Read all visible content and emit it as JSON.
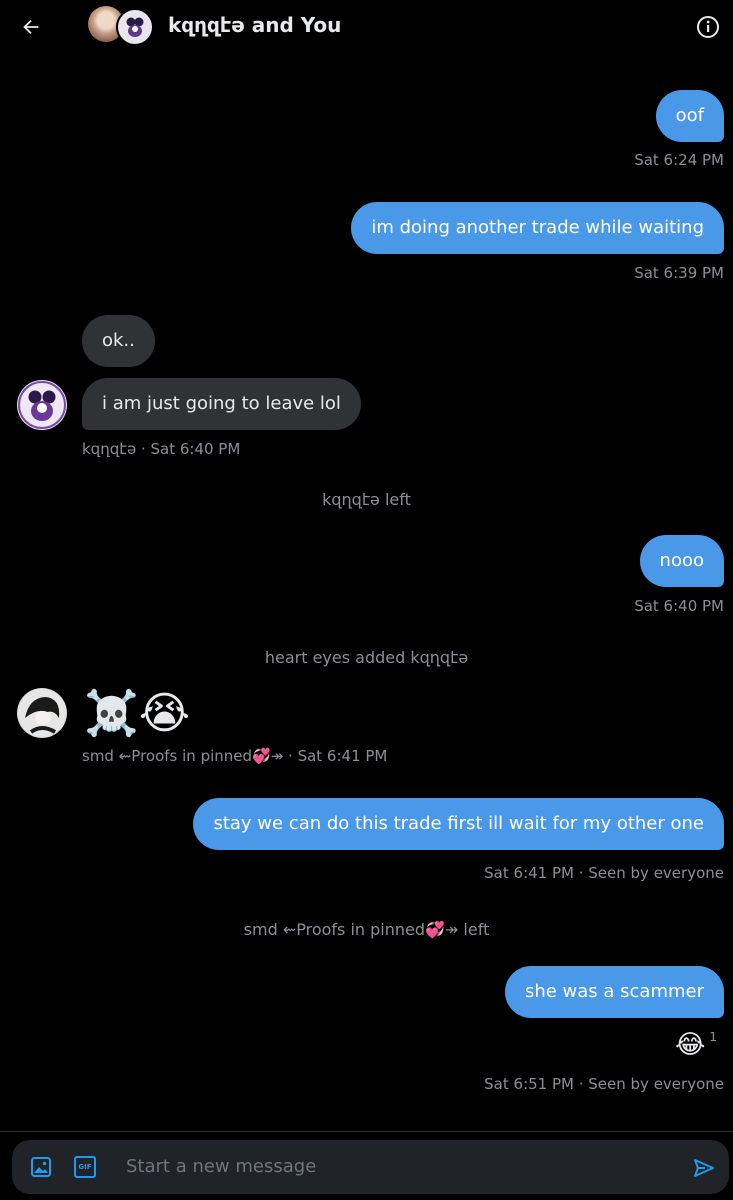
{
  "header": {
    "title": "kզղզէә and You"
  },
  "messages": [
    {
      "text": "oof",
      "time": "Sat 6:24 PM"
    },
    {
      "text": "im doing another trade while waiting",
      "time": "Sat 6:39 PM"
    },
    {
      "text": "ok.."
    },
    {
      "text": "i am just going to leave lol",
      "meta": "kզղզէә · Sat 6:40 PM"
    },
    {
      "text": "kզղզէә left"
    },
    {
      "text": "nooo",
      "time": "Sat 6:40 PM"
    },
    {
      "text": "heart eyes added kզղզէә"
    },
    {
      "text": "☠️😭",
      "meta": "smd ⇜Proofs in pinned💞↠ · Sat 6:41 PM"
    },
    {
      "text": "stay we can do this trade first ill wait for my other one",
      "time": "Sat 6:41 PM",
      "seen": "· Seen by everyone"
    },
    {
      "text": "smd ⇜Proofs in pinned💞↠ left"
    },
    {
      "text": "she was a scammer",
      "reaction": "😂",
      "reaction_count": "1",
      "time": "Sat 6:51 PM",
      "seen": "· Seen by everyone"
    }
  ],
  "composer": {
    "placeholder": "Start a new message",
    "gif_label": "GIF"
  },
  "colors": {
    "accent": "#1d9bf0",
    "my_bubble": "#4a99e9",
    "their_bubble": "#2f3336"
  },
  "icons": [
    "back-arrow-icon",
    "info-icon",
    "image-icon",
    "gif-icon",
    "send-icon"
  ]
}
